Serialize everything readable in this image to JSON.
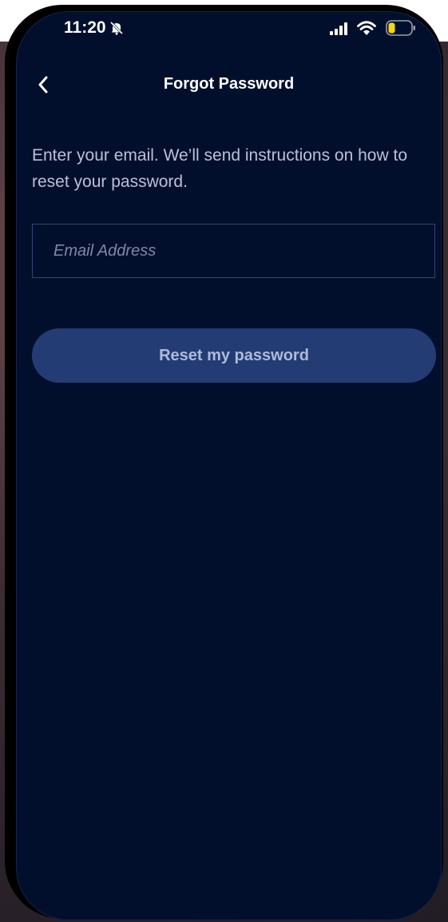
{
  "status_bar": {
    "time": "11:20",
    "icons": [
      "bell-off-icon",
      "signal-icon",
      "wifi-icon",
      "battery-icon"
    ],
    "battery_color": "#f5d90a"
  },
  "header": {
    "back_icon": "chevron-left-icon",
    "title": "Forgot Password"
  },
  "main": {
    "instructions": "Enter your email. We’ll send instructions on how to reset your password.",
    "email_field": {
      "placeholder": "Email Address",
      "value": ""
    },
    "reset_button_label": "Reset my password"
  },
  "colors": {
    "background": "#020f2c",
    "button": "#243c74",
    "field_border": "#34476f"
  }
}
